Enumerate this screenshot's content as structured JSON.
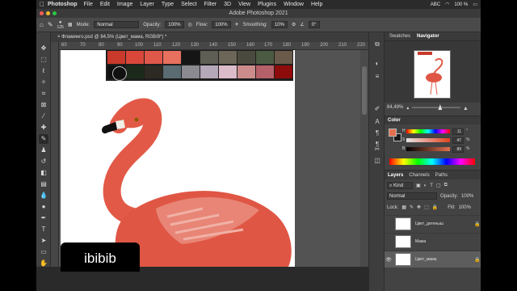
{
  "menubar": {
    "app_name": "Photoshop",
    "items": [
      "File",
      "Edit",
      "Image",
      "Layer",
      "Type",
      "Select",
      "Filter",
      "3D",
      "View",
      "Plugins",
      "Window",
      "Help"
    ],
    "status": {
      "input": "ABC",
      "battery": "100 %"
    }
  },
  "window": {
    "title": "Adobe Photoshop 2021"
  },
  "options": {
    "brush_size": "125",
    "mode_label": "Mode:",
    "mode_value": "Normal",
    "opacity_label": "Opacity:",
    "opacity_value": "100%",
    "flow_label": "Flow:",
    "flow_value": "100%",
    "smoothing_label": "Smoothing:",
    "smoothing_value": "10%",
    "angle_value": "0°"
  },
  "document": {
    "tab_title": "Фламинго.psd @ 84,5% (Цвет_мама, RGB/8*) *"
  },
  "ruler": {
    "ticks": [
      "60",
      "70",
      "80",
      "90",
      "100",
      "110",
      "120",
      "130",
      "140",
      "150",
      "160",
      "170",
      "180",
      "190",
      "200",
      "210",
      "220"
    ]
  },
  "swatches_popup": {
    "row1": [
      "#c93a2c",
      "#d9473a",
      "#e0584a",
      "#e8705e",
      "#151515",
      "#5e5e55",
      "#6b6658",
      "#4a4b3e",
      "#4b5a42",
      "#6a5a4a"
    ],
    "row2": [
      "#111111",
      "#1b2a1b",
      "#2c2a22",
      "#5a6b72",
      "#8a8a90",
      "#b5a8b8",
      "#dcbcc8",
      "#cc8c8c",
      "#b66069",
      "#8e0b0b"
    ]
  },
  "panels": {
    "top_tabs": [
      "Swatches",
      "Navigator"
    ],
    "zoom": "84,49%",
    "color": {
      "title": "Color",
      "h_label": "H",
      "h_value": "11",
      "s_label": "S",
      "s_value": "47",
      "b_label": "B",
      "b_value": "89",
      "unit": "°",
      "percent": "%",
      "foreground": "#e3704f",
      "background": "#1a1a1a"
    },
    "layers": {
      "tabs": [
        "Layers",
        "Channels",
        "Paths"
      ],
      "filter_label": "Kind",
      "blend_mode": "Normal",
      "opacity_label": "Opacity:",
      "opacity_value": "100%",
      "lock_label": "Lock:",
      "fill_label": "Fill:",
      "fill_value": "100%",
      "items": [
        "Цвет_детеныш",
        "Мама",
        "Цвет_мама"
      ]
    }
  },
  "watermark": "ibibib"
}
